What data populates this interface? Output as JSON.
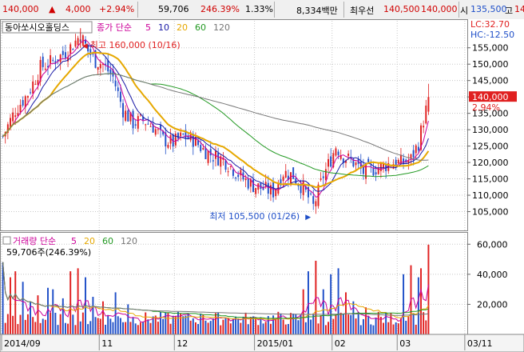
{
  "quote": {
    "price": "140,000",
    "arrow": "▲",
    "change": "4,000",
    "change_pct": "+2.94%",
    "volume": "59,706",
    "vol_ratio": "246.39%",
    "turnover": "1.33%",
    "amount": "8,334백만",
    "max_label": "최우선",
    "bid": "140,500",
    "ask": "140,000",
    "open_label": "시",
    "open": "135,500",
    "high_label": "고",
    "high_cut": "14"
  },
  "price_panel": {
    "stock_name": "동아쏘시오홀딩스",
    "legend_prefix": "종가 단순",
    "ma_labels": [
      "5",
      "10",
      "20",
      "60",
      "120"
    ],
    "ma_colors": [
      "#cc0099",
      "#1a1aa6",
      "#e6a800",
      "#229922",
      "#777777"
    ],
    "lc": "LC:32.70",
    "hc": "HC:-12.50",
    "last_price": "140,000",
    "last_pct": "2.94%",
    "high_note": "최고 160,000 (10/16)",
    "low_note": "최저 105,500 (01/26)"
  },
  "volume_panel": {
    "title": "거래량 단순",
    "ma_labels": [
      "5",
      "20",
      "60",
      "120"
    ],
    "ma_colors": [
      "#cc0099",
      "#e6a800",
      "#229922",
      "#777777"
    ],
    "last_note": "59,706주(246.39%)"
  },
  "chart_data": {
    "type": "candlestick",
    "up_color": "#e02020",
    "down_color": "#1f4fc8",
    "price_ylim": [
      100000,
      162500
    ],
    "price_ticks": [
      105000,
      110000,
      115000,
      120000,
      125000,
      130000,
      135000,
      140000,
      145000,
      150000,
      155000
    ],
    "price_tick_labels": [
      "105,000",
      "110,000",
      "115,000",
      "120,000",
      "125,000",
      "130,000",
      "135,000",
      "140,000",
      "145,000",
      "150,000",
      "155,000"
    ],
    "volume_ylim": [
      0,
      66000
    ],
    "volume_ticks": [
      20000,
      40000,
      60000
    ],
    "volume_tick_labels": [
      "20,000",
      "40,000",
      "60,000"
    ],
    "x_labels": [
      {
        "label": "2014/09",
        "index": 0
      },
      {
        "label": "11",
        "index": 39
      },
      {
        "label": "12",
        "index": 69
      },
      {
        "label": "2015/01",
        "index": 101
      },
      {
        "label": "02",
        "index": 132
      },
      {
        "label": "03",
        "index": 158
      },
      {
        "label": "03/11",
        "index": 185
      }
    ],
    "ohlc_anchors": [
      [
        0,
        128000
      ],
      [
        5,
        136000
      ],
      [
        10,
        141000
      ],
      [
        15,
        149000
      ],
      [
        20,
        151000
      ],
      [
        24,
        153000
      ],
      [
        28,
        156000
      ],
      [
        31,
        159000
      ],
      [
        34,
        154000
      ],
      [
        37,
        151000
      ],
      [
        40,
        150000
      ],
      [
        44,
        146000
      ],
      [
        48,
        136000
      ],
      [
        52,
        132000
      ],
      [
        56,
        133000
      ],
      [
        60,
        131000
      ],
      [
        64,
        127000
      ],
      [
        68,
        126000
      ],
      [
        72,
        128000
      ],
      [
        76,
        127000
      ],
      [
        80,
        124000
      ],
      [
        84,
        122000
      ],
      [
        88,
        121000
      ],
      [
        92,
        118000
      ],
      [
        96,
        115000
      ],
      [
        100,
        113000
      ],
      [
        104,
        112000
      ],
      [
        108,
        111000
      ],
      [
        112,
        117000
      ],
      [
        116,
        116000
      ],
      [
        120,
        112000
      ],
      [
        123,
        108000
      ],
      [
        124,
        106500
      ],
      [
        126,
        111000
      ],
      [
        128,
        116000
      ],
      [
        131,
        121000
      ],
      [
        133,
        125000
      ],
      [
        136,
        122000
      ],
      [
        140,
        120000
      ],
      [
        144,
        117000
      ],
      [
        148,
        118000
      ],
      [
        152,
        119000
      ],
      [
        156,
        120000
      ],
      [
        160,
        120000
      ],
      [
        163,
        121000
      ],
      [
        166,
        126000
      ],
      [
        168,
        133000
      ],
      [
        169,
        136000
      ],
      [
        170,
        140000
      ]
    ],
    "volume_spikes": [
      [
        0,
        48000
      ],
      [
        3,
        38000
      ],
      [
        5,
        42000
      ],
      [
        8,
        35000
      ],
      [
        11,
        22000
      ],
      [
        14,
        26000
      ],
      [
        18,
        31000
      ],
      [
        20,
        30000
      ],
      [
        24,
        24000
      ],
      [
        27,
        42000
      ],
      [
        30,
        44000
      ],
      [
        33,
        38000
      ],
      [
        36,
        25000
      ],
      [
        40,
        22000
      ],
      [
        45,
        28000
      ],
      [
        50,
        20000
      ],
      [
        60,
        12000
      ],
      [
        70,
        15000
      ],
      [
        80,
        13000
      ],
      [
        90,
        11000
      ],
      [
        100,
        12000
      ],
      [
        110,
        15000
      ],
      [
        120,
        30000
      ],
      [
        122,
        42000
      ],
      [
        125,
        49000
      ],
      [
        128,
        30000
      ],
      [
        131,
        40000
      ],
      [
        134,
        44000
      ],
      [
        137,
        28000
      ],
      [
        140,
        22000
      ],
      [
        145,
        18000
      ],
      [
        150,
        15000
      ],
      [
        160,
        40000
      ],
      [
        163,
        46000
      ],
      [
        166,
        38000
      ],
      [
        167,
        44000
      ],
      [
        170,
        59706
      ]
    ]
  }
}
